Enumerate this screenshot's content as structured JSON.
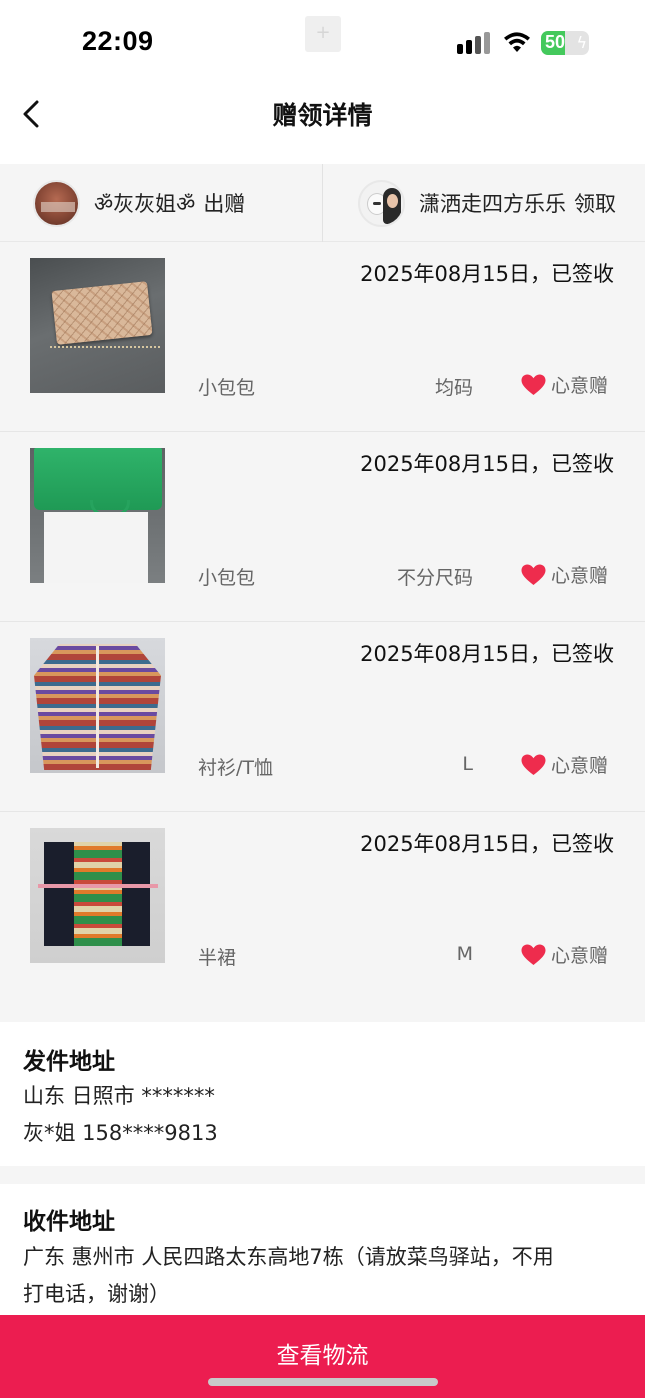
{
  "status_bar": {
    "time": "22:09",
    "battery": "50",
    "center_icon": "+"
  },
  "nav": {
    "title": "赠领详情"
  },
  "parties": {
    "giver": {
      "name": "ॐ灰灰姐ॐ",
      "action": "出赠"
    },
    "receiver": {
      "name": "潇洒走四方乐乐",
      "action": "领取"
    }
  },
  "items": [
    {
      "date": "2025年08月15日，已签收",
      "category": "小包包",
      "size": "均码",
      "tag": "心意赠"
    },
    {
      "date": "2025年08月15日，已签收",
      "category": "小包包",
      "size": "不分尺码",
      "tag": "心意赠"
    },
    {
      "date": "2025年08月15日，已签收",
      "category": "衬衫/T恤",
      "size": "L",
      "tag": "心意赠"
    },
    {
      "date": "2025年08月15日，已签收",
      "category": "半裙",
      "size": "M",
      "tag": "心意赠"
    }
  ],
  "sender_address": {
    "title": "发件地址",
    "region": "山东 日照市 *******",
    "contact": "灰*姐 158****9813"
  },
  "receiver_address": {
    "title": "收件地址",
    "line1": "广东 惠州市 人民四路太东高地7栋（请放菜鸟驿站，不用",
    "line2": "打电话，谢谢）"
  },
  "actions": {
    "logistics_label": "查看物流"
  },
  "colors": {
    "accent": "#ec1d50",
    "heart": "#ee2c4d",
    "battery_green": "#44c95c"
  }
}
